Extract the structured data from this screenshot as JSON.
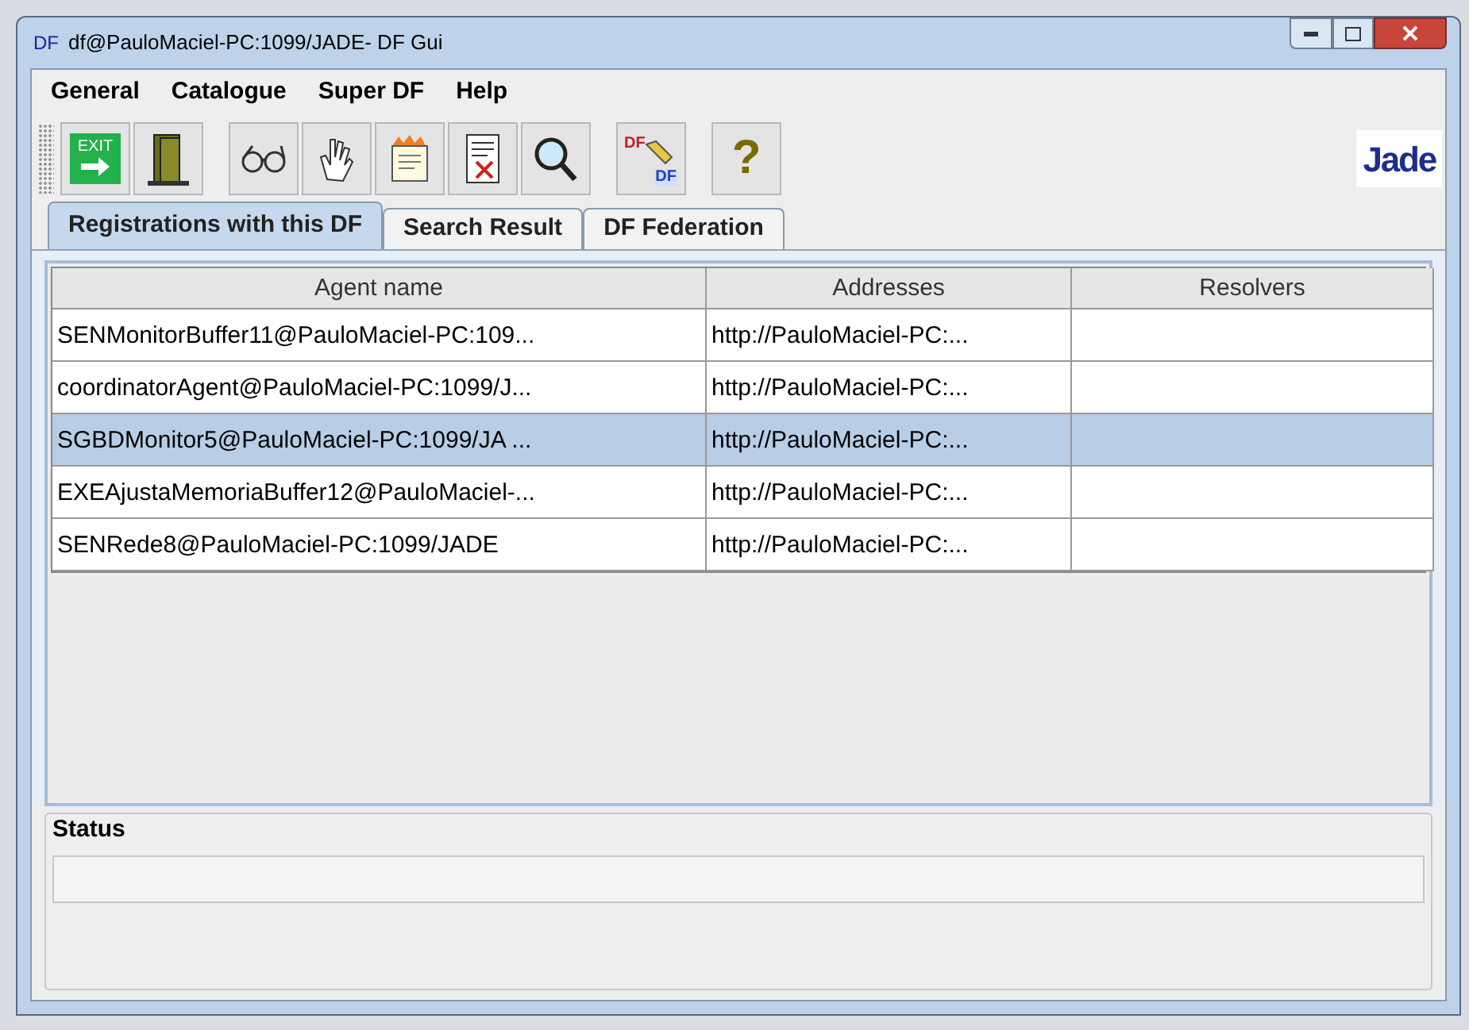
{
  "window": {
    "title": "df@PauloMaciel-PC:1099/JADE- DF Gui",
    "title_icon": "DF"
  },
  "menu": [
    "General",
    "Catalogue",
    "Super DF",
    "Help"
  ],
  "toolbar": [
    {
      "kind": "exit",
      "label": "EXIT"
    },
    {
      "kind": "door"
    },
    {
      "kind": "glasses"
    },
    {
      "kind": "hand"
    },
    {
      "kind": "scroll"
    },
    {
      "kind": "document"
    },
    {
      "kind": "search"
    },
    {
      "kind": "federate",
      "label": "DF",
      "label2": "DF"
    },
    {
      "kind": "help",
      "label": "?"
    }
  ],
  "logo": "Jade",
  "tabs": [
    {
      "label": "Registrations with this DF",
      "selected": true
    },
    {
      "label": "Search Result",
      "selected": false
    },
    {
      "label": "DF Federation",
      "selected": false
    }
  ],
  "table": {
    "columns": [
      "Agent name",
      "Addresses",
      "Resolvers"
    ],
    "rows": [
      {
        "cells": [
          "SENMonitorBuffer11@PauloMaciel-PC:109...",
          "http://PauloMaciel-PC:...",
          ""
        ],
        "selected": false
      },
      {
        "cells": [
          "coordinatorAgent@PauloMaciel-PC:1099/J...",
          "http://PauloMaciel-PC:...",
          ""
        ],
        "selected": false
      },
      {
        "cells": [
          "SGBDMonitor5@PauloMaciel-PC:1099/JA ...",
          "http://PauloMaciel-PC:...",
          ""
        ],
        "selected": true
      },
      {
        "cells": [
          "EXEAjustaMemoriaBuffer12@PauloMaciel-...",
          "http://PauloMaciel-PC:...",
          ""
        ],
        "selected": false
      },
      {
        "cells": [
          "SENRede8@PauloMaciel-PC:1099/JADE",
          "http://PauloMaciel-PC:...",
          ""
        ],
        "selected": false
      }
    ]
  },
  "status": {
    "title": "Status"
  }
}
